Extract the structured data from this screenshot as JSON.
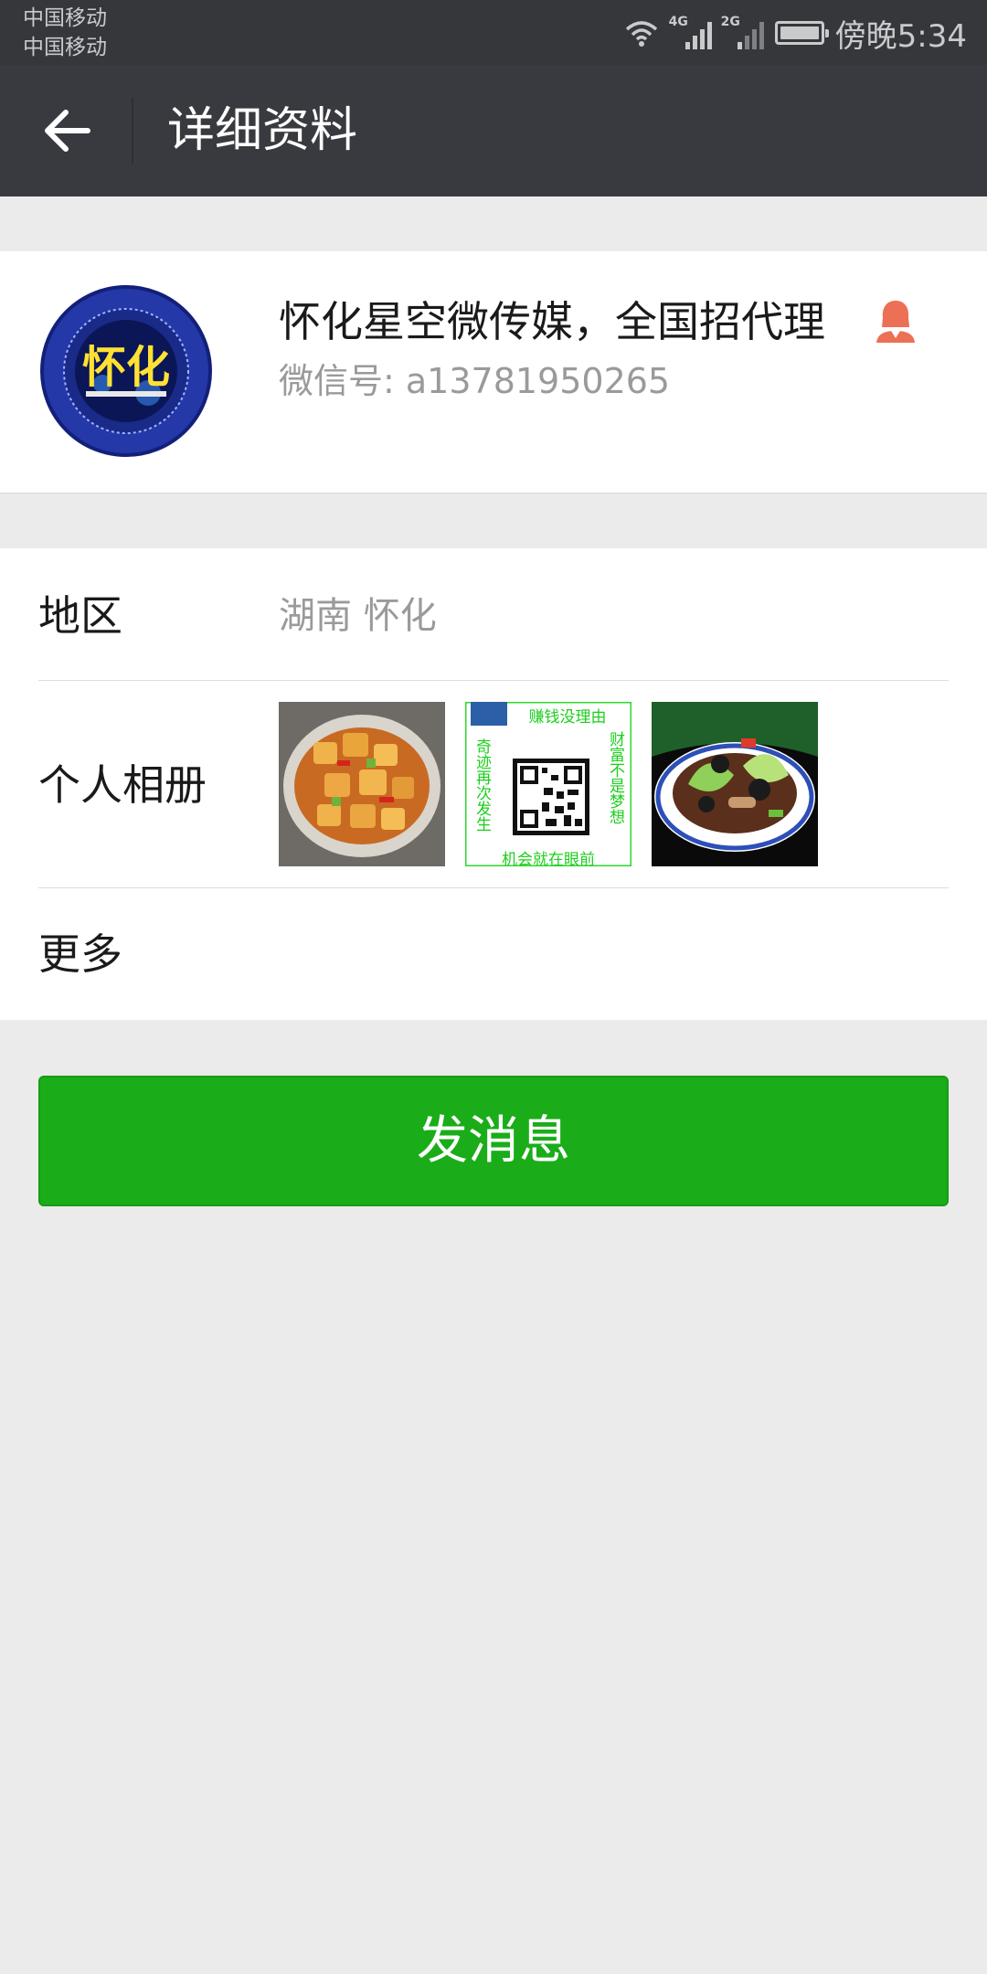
{
  "status_bar": {
    "carrier_1": "中国移动",
    "carrier_2": "中国移动",
    "network_1": "4G",
    "network_2": "2G",
    "time": "傍晚5:34",
    "icons": [
      "wifi-icon",
      "signal-icon",
      "signal-icon",
      "battery-icon"
    ]
  },
  "header": {
    "title": "详细资料",
    "back_icon": "arrow-left-icon"
  },
  "profile": {
    "name": "怀化星空微传媒，全国招代理",
    "wechat_id": "微信号: a13781950265",
    "gender_icon": "female-icon",
    "avatar_text": "怀化"
  },
  "rows": {
    "region": {
      "label": "地区",
      "value": "湖南  怀化"
    },
    "album": {
      "label": "个人相册",
      "photo_2": {
        "top_text": "赚钱没理由",
        "left_text": "奇迹再次发生",
        "right_text": "财富不是梦想",
        "bottom_text": "机会就在眼前"
      }
    },
    "more": {
      "label": "更多"
    }
  },
  "actions": {
    "send_message": "发消息"
  },
  "colors": {
    "status_bar": "#35373b",
    "header": "#393a3f",
    "background": "#ebebeb",
    "accent_green": "#1aad19",
    "female_icon": "#ec7055"
  }
}
